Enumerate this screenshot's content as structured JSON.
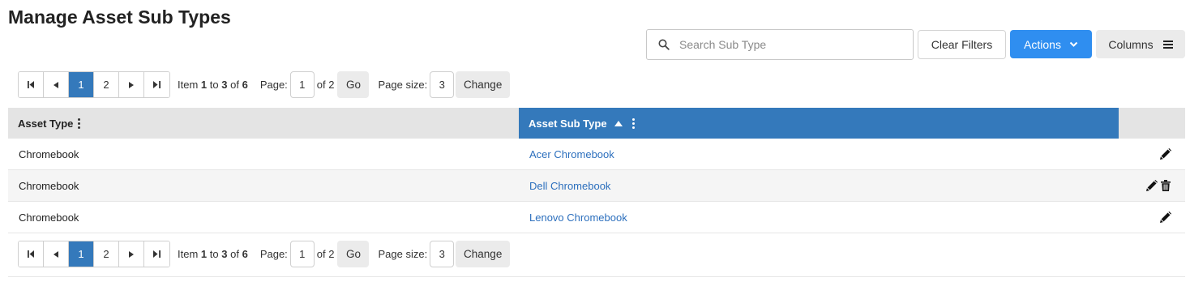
{
  "page": {
    "title": "Manage Asset Sub Types"
  },
  "toolbar": {
    "search_placeholder": "Search Sub Type",
    "search_value": "",
    "clear_filters_label": "Clear Filters",
    "actions_label": "Actions",
    "columns_label": "Columns",
    "accent_color": "#2f8ef0"
  },
  "pager": {
    "pages": [
      "1",
      "2"
    ],
    "current_page": "1",
    "item_prefix": "Item",
    "item_from": "1",
    "item_to_word": "to",
    "item_to": "3",
    "item_of_word": "of",
    "item_total": "6",
    "page_label": "Page:",
    "page_value": "1",
    "page_of": "of 2",
    "go_label": "Go",
    "page_size_label": "Page size:",
    "page_size_value": "3",
    "change_label": "Change"
  },
  "grid": {
    "columns": [
      {
        "label": "Asset Type"
      },
      {
        "label": "Asset Sub Type",
        "sort": "ascending"
      }
    ],
    "header_active_color": "#3479bb",
    "link_color": "#2c6fbd",
    "rows": [
      {
        "asset_type": "Chromebook",
        "asset_sub_type": "Acer Chromebook",
        "actions": [
          "pencil-icon"
        ]
      },
      {
        "asset_type": "Chromebook",
        "asset_sub_type": "Dell Chromebook",
        "actions": [
          "pencil-icon",
          "trash-icon"
        ]
      },
      {
        "asset_type": "Chromebook",
        "asset_sub_type": "Lenovo Chromebook",
        "actions": [
          "pencil-icon"
        ]
      }
    ]
  }
}
